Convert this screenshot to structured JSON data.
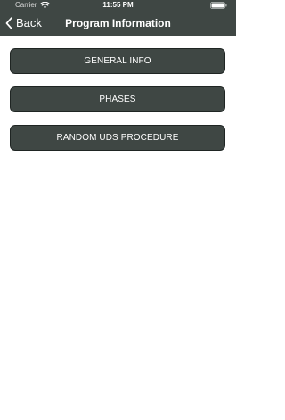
{
  "status_bar": {
    "carrier": "Carrier",
    "time": "11:55 PM"
  },
  "nav": {
    "back_label": "Back",
    "title": "Program Information"
  },
  "menu": {
    "items": [
      {
        "label": "GENERAL INFO"
      },
      {
        "label": "PHASES"
      },
      {
        "label": "RANDOM UDS PROCEDURE"
      }
    ]
  },
  "colors": {
    "header_background": "#3f4744",
    "button_background": "#3f4744",
    "button_text": "#ffffff",
    "page_background": "#ffffff"
  },
  "icons": {
    "wifi": "wifi-icon",
    "battery": "battery-icon",
    "back": "chevron-left-icon"
  }
}
